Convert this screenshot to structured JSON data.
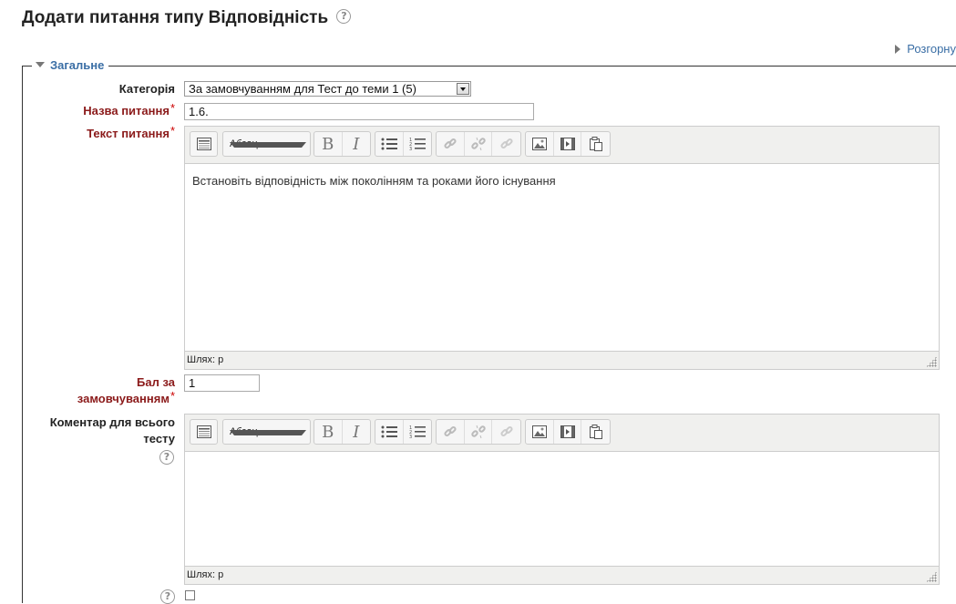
{
  "page": {
    "title": "Додати питання типу Відповідність",
    "help_glyph": "?",
    "expand_all": "Розгорну"
  },
  "section": {
    "legend": "Загальне"
  },
  "form": {
    "category": {
      "label": "Категорія",
      "value": "За замовчуванням для Тест до теми 1 (5)"
    },
    "question_name": {
      "label": "Назва питання",
      "required_mark": "*",
      "value": "1.6."
    },
    "question_text": {
      "label": "Текст питання",
      "required_mark": "*",
      "body": "Встановіть відповідність між поколінням та роками його існування",
      "format": "Абзац",
      "path": "Шлях: p"
    },
    "default_mark": {
      "label_line1": "Бал за",
      "label_line2": "замовчуванням",
      "required_mark": "*",
      "value": "1"
    },
    "general_feedback": {
      "label_line1": "Коментар для всього",
      "label_line2": "тесту",
      "body": "",
      "format": "Абзац",
      "path": "Шлях: p"
    }
  },
  "toolbar": {
    "bold": "B",
    "italic": "I",
    "icons": [
      "toggle-toolbar-icon",
      "bold-icon",
      "italic-icon",
      "bulleted-list-icon",
      "numbered-list-icon",
      "link-icon",
      "unlink-icon",
      "anchor-icon",
      "image-icon",
      "media-icon",
      "paste-icon"
    ]
  },
  "colors": {
    "accent": "#3a6ea5",
    "required": "#8b1a1a",
    "star": "#cc0000"
  }
}
